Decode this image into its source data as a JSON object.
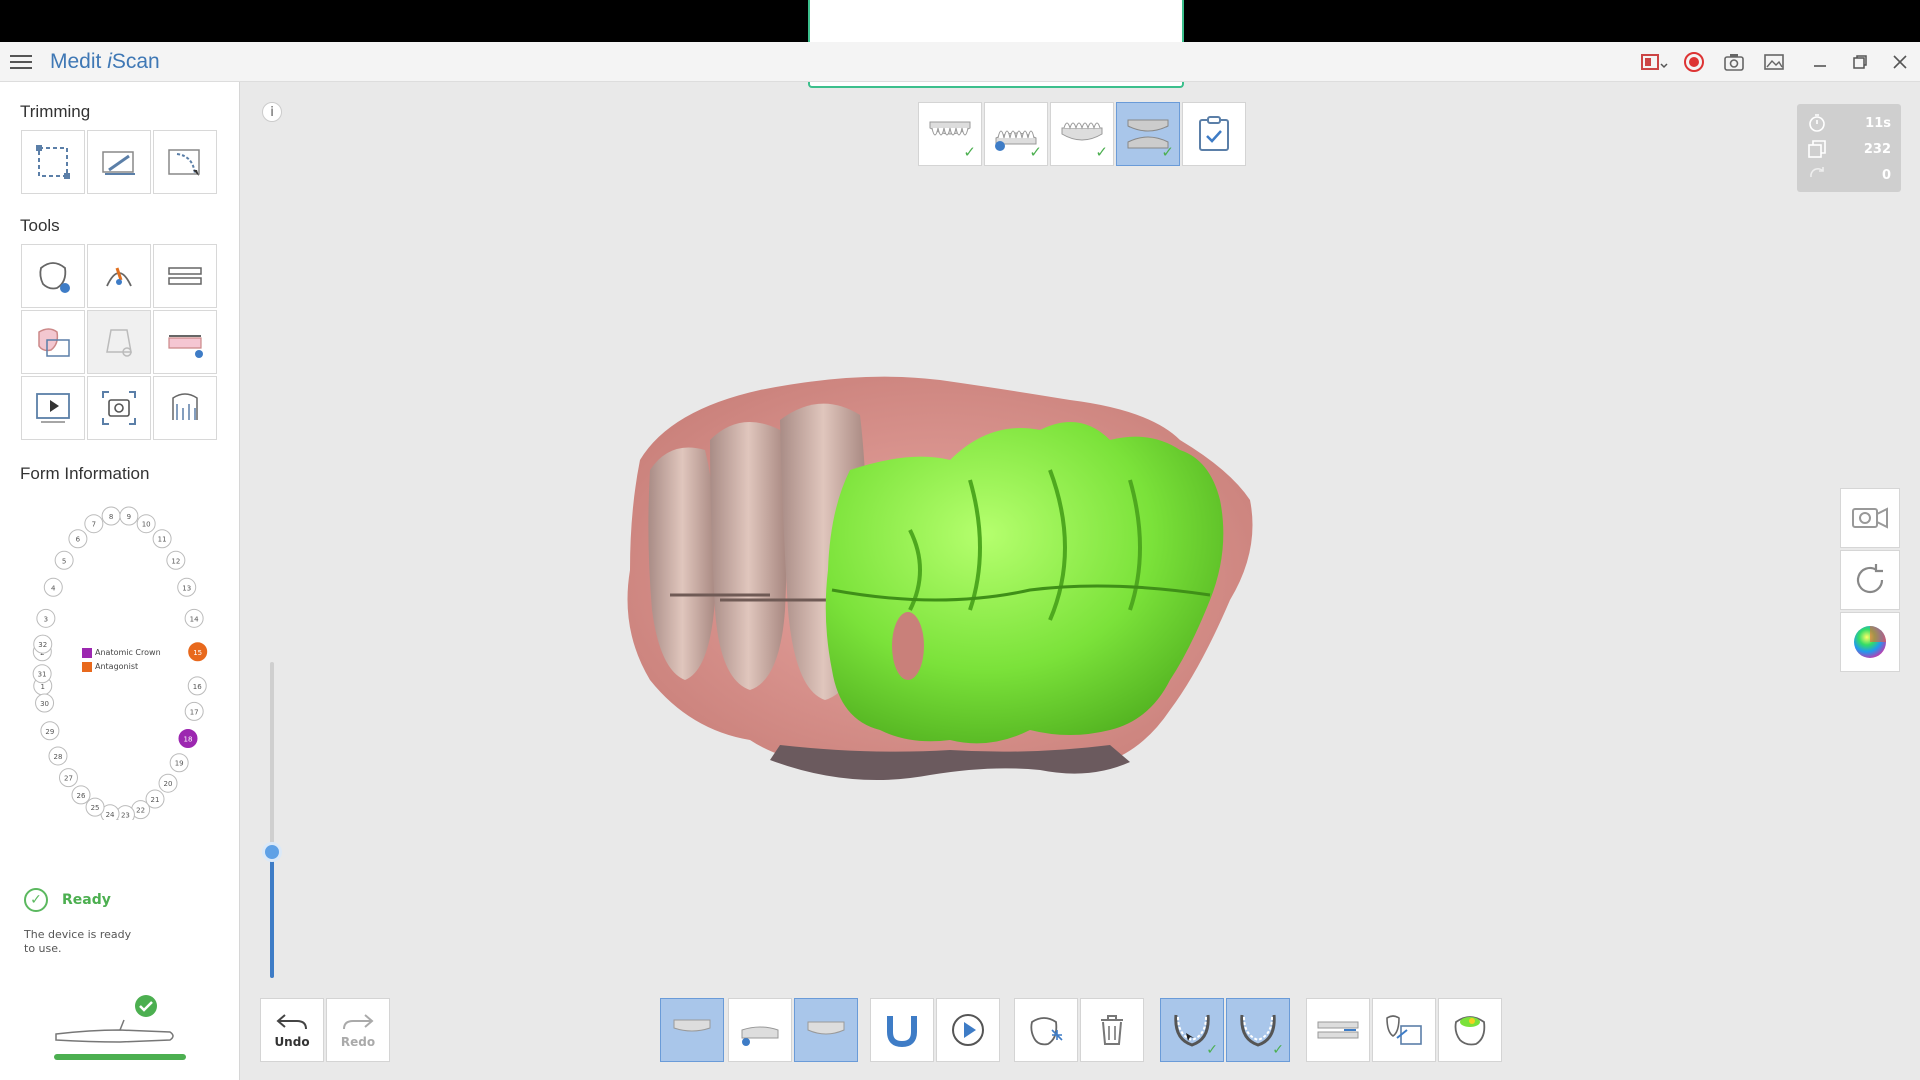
{
  "app": {
    "title_left": "Medit ",
    "title_italic": "i",
    "title_right": "Scan"
  },
  "left_panel": {
    "trimming_title": "Trimming",
    "tools_title": "Tools",
    "form_info_title": "Form Information",
    "legend": {
      "items": [
        {
          "label": "Anatomic Crown",
          "color": "#9c27b0"
        },
        {
          "label": "Antagonist",
          "color": "#e8691d"
        }
      ]
    },
    "status": {
      "label": "Ready",
      "description": "The device is ready to use."
    }
  },
  "tooth_chart": {
    "upper": [
      "1",
      "2",
      "3",
      "4",
      "5",
      "6",
      "7",
      "8",
      "9",
      "10",
      "11",
      "12",
      "13",
      "14",
      "15",
      "16"
    ],
    "lower": [
      "17",
      "18",
      "19",
      "20",
      "21",
      "22",
      "23",
      "24",
      "25",
      "26",
      "27",
      "28",
      "29",
      "30",
      "31",
      "32"
    ],
    "highlight_antagonist": "15",
    "highlight_crown": "18",
    "colors": {
      "antagonist": "#e8691d",
      "crown": "#9c27b0"
    }
  },
  "stats": {
    "time": "11s",
    "frames": "232",
    "count": "0"
  },
  "bottom_toolbar": {
    "undo_label": "Undo",
    "redo_label": "Redo"
  },
  "colors": {
    "accent": "#3e7cc6",
    "active_button": "#a9c6ea",
    "ready_green": "#4caf50",
    "scan_green": "#7be23a"
  }
}
